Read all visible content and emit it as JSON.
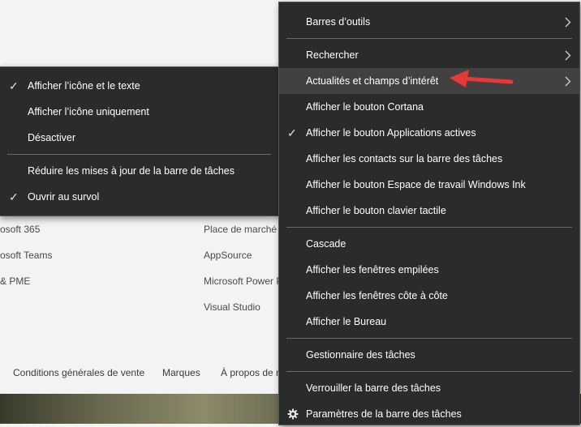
{
  "background": {
    "col1": [
      "osoft 365",
      "osoft Teams",
      "& PME"
    ],
    "col2": [
      "Place de marché A",
      "AppSource",
      "Microsoft Power P",
      "Visual Studio"
    ],
    "footer_links": [
      "Conditions générales de vente",
      "Marques",
      "À propos de n"
    ],
    "edge_char": "i"
  },
  "submenu": {
    "items": [
      {
        "label": "Afficher l’icône et le texte",
        "checked": true
      },
      {
        "label": "Afficher l’icône uniquement",
        "checked": false
      },
      {
        "label": "Désactiver",
        "checked": false
      },
      {
        "label": "Réduire les mises à jour de la barre de tâches",
        "checked": false
      },
      {
        "label": "Ouvrir au survol",
        "checked": true
      }
    ]
  },
  "context_menu": {
    "items": [
      {
        "label": "Barres d’outils",
        "submenu": true
      },
      {
        "label": "Rechercher",
        "submenu": true
      },
      {
        "label": "Actualités et champs d’intérêt",
        "submenu": true,
        "highlighted": true
      },
      {
        "label": "Afficher le bouton Cortana"
      },
      {
        "label": "Afficher le bouton Applications actives",
        "checked": true
      },
      {
        "label": "Afficher les contacts sur la barre des tâches"
      },
      {
        "label": "Afficher le bouton Espace de travail Windows Ink"
      },
      {
        "label": "Afficher le bouton clavier tactile"
      },
      {
        "label": "Cascade"
      },
      {
        "label": "Afficher les fenêtres empilées"
      },
      {
        "label": "Afficher les fenêtres côte à côte"
      },
      {
        "label": "Afficher le Bureau"
      },
      {
        "label": "Gestionnaire des tâches"
      },
      {
        "label": "Verrouiller la barre des tâches"
      },
      {
        "label": "Paramètres de la barre des tâches",
        "icon": "gear-icon"
      }
    ]
  },
  "colors": {
    "menu_bg": "#2b2b2b",
    "menu_highlight": "#414141",
    "annotation_arrow": "#e53935"
  }
}
